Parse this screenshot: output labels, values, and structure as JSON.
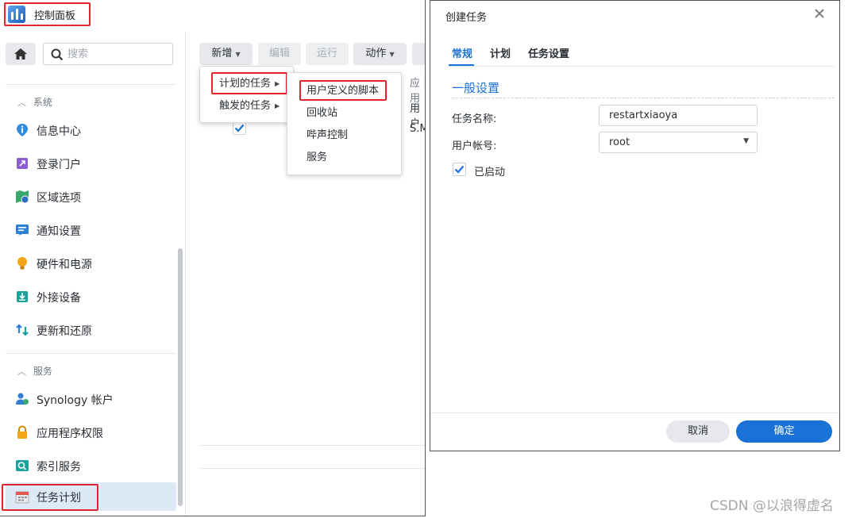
{
  "control_panel": {
    "title": "控制面板",
    "search_placeholder": "搜索",
    "groups": [
      {
        "label": "系统",
        "items": [
          {
            "label": "信息中心",
            "icon": "info-icon"
          },
          {
            "label": "登录门户",
            "icon": "login-portal-icon"
          },
          {
            "label": "区域选项",
            "icon": "regional-options-icon"
          },
          {
            "label": "通知设置",
            "icon": "notification-icon"
          },
          {
            "label": "硬件和电源",
            "icon": "hardware-power-icon"
          },
          {
            "label": "外接设备",
            "icon": "external-devices-icon"
          },
          {
            "label": "更新和还原",
            "icon": "update-restore-icon"
          }
        ]
      },
      {
        "label": "服务",
        "items": [
          {
            "label": "Synology 帐户",
            "icon": "synology-account-icon"
          },
          {
            "label": "应用程序权限",
            "icon": "app-privileges-icon"
          },
          {
            "label": "索引服务",
            "icon": "indexing-service-icon"
          },
          {
            "label": "任务计划",
            "icon": "task-scheduler-icon",
            "active": true
          }
        ]
      }
    ],
    "toolbar": {
      "create": "新增",
      "edit": "编辑",
      "run": "运行",
      "action": "动作"
    },
    "table": {
      "header_partial": "应用",
      "rows_partial": [
        "用户",
        "S.M"
      ]
    },
    "create_menu": {
      "items": [
        "计划的任务",
        "触发的任务"
      ]
    },
    "submenu": {
      "items": [
        "用户定义的脚本",
        "回收站",
        "哔声控制",
        "服务"
      ]
    }
  },
  "dialog": {
    "title": "创建任务",
    "tabs": [
      "常规",
      "计划",
      "任务设置"
    ],
    "section_title": "一般设置",
    "fields": {
      "task_name_label": "任务名称:",
      "task_name_value": "restartxiaoya",
      "user_label": "用户帐号:",
      "user_value": "root",
      "enabled_label": "已启动"
    },
    "buttons": {
      "cancel": "取消",
      "ok": "确定"
    }
  },
  "watermark": "CSDN @以浪得虚名",
  "colors": {
    "accent": "#1b72d6",
    "highlight": "#e0262b",
    "active_bg": "#dde9f6"
  }
}
